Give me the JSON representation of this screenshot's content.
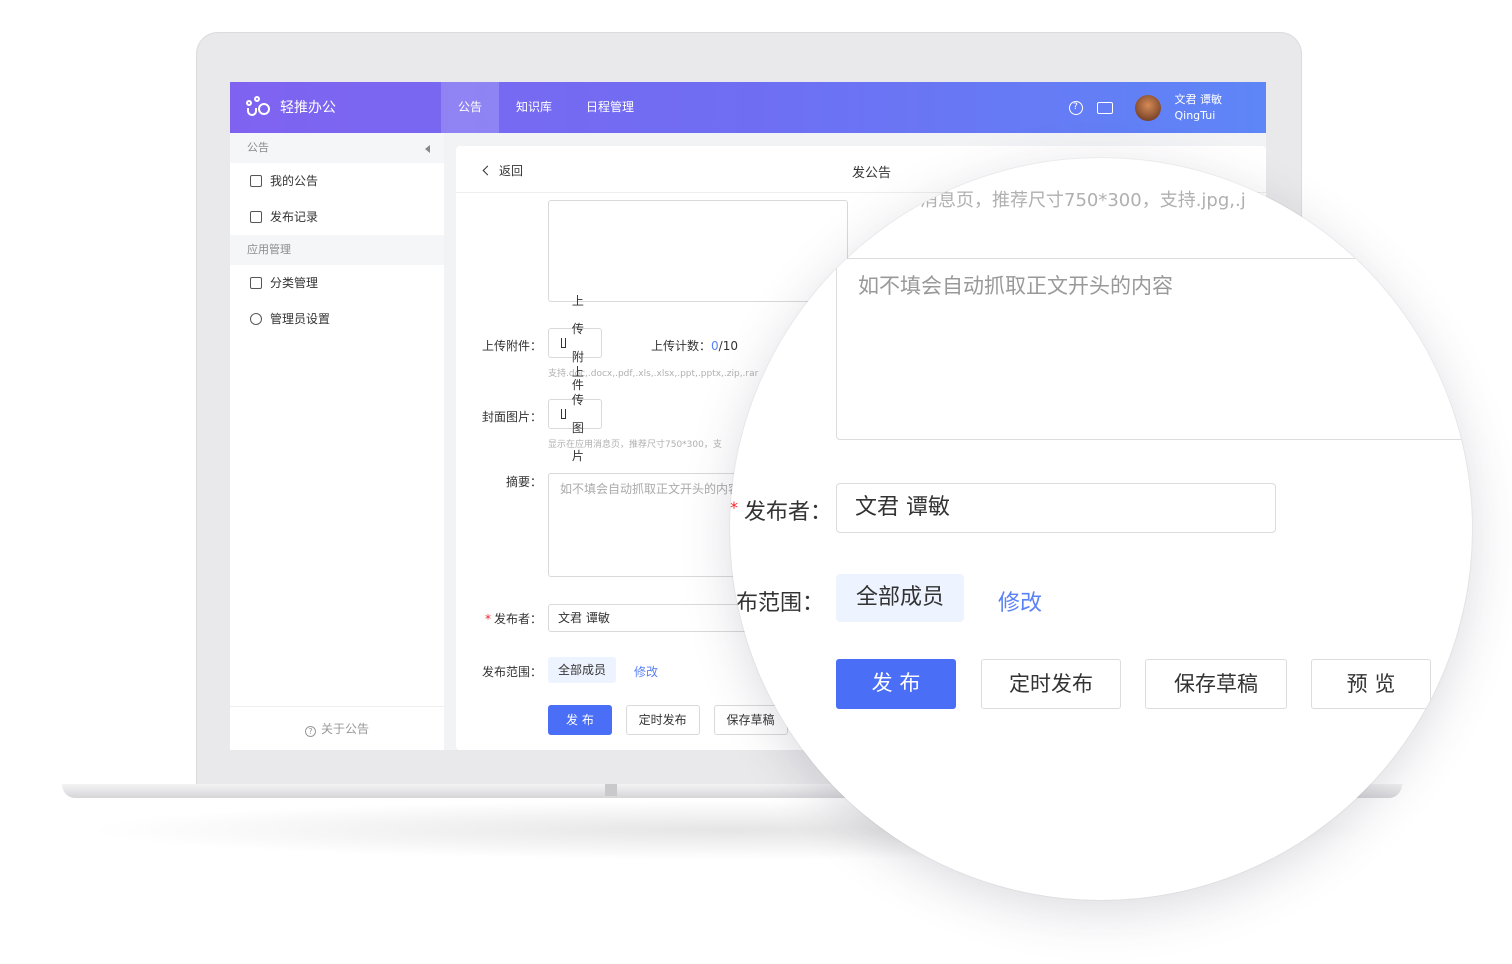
{
  "brand": {
    "name": "轻推办公"
  },
  "nav": {
    "items": [
      "公告",
      "知识库",
      "日程管理"
    ]
  },
  "user": {
    "name": "文君 谭敏",
    "org": "QingTui"
  },
  "sidebar": {
    "group1": "公告",
    "items1": [
      "我的公告",
      "发布记录"
    ],
    "group2": "应用管理",
    "items2": [
      "分类管理",
      "管理员设置"
    ],
    "footer": "关于公告"
  },
  "content": {
    "back": "返回",
    "title": "发公告",
    "attach_label": "上传附件：",
    "attach_button": "上传附件",
    "attach_count_label": "上传计数：",
    "attach_count_value": "0",
    "attach_count_max": "/10",
    "attach_hint": "支持.doc,.docx,.pdf,.xls,.xlsx,.ppt,.pptx,.zip,.rar",
    "cover_label": "封面图片：",
    "cover_button": "上传图片",
    "cover_hint": "显示在应用消息页，推荐尺寸750*300，支",
    "summary_label": "摘要：",
    "summary_placeholder": "如不填会自动抓取正文开头的内容",
    "publisher_label": "发布者：",
    "publisher_value": "文君 谭敏",
    "scope_label": "发布范围：",
    "scope_value": "全部成员",
    "scope_edit": "修改",
    "btn_publish": "发 布",
    "btn_schedule": "定时发布",
    "btn_draft": "保存草稿"
  },
  "magnifier": {
    "top_hint": "消息页，推荐尺寸750*300，支持.jpg,.j",
    "summary_placeholder": "如不填会自动抓取正文开头的内容",
    "publisher_label": "发布者：",
    "publisher_value": "文君 谭敏",
    "scope_label": "布范围：",
    "scope_value": "全部成员",
    "scope_edit": "修改",
    "btn_publish": "发 布",
    "btn_schedule": "定时发布",
    "btn_draft": "保存草稿",
    "btn_preview": "预 览"
  },
  "colors": {
    "primary": "#4a6ef5",
    "header_start": "#7f63f0",
    "header_end": "#5e86f7",
    "link": "#5b82f5"
  }
}
